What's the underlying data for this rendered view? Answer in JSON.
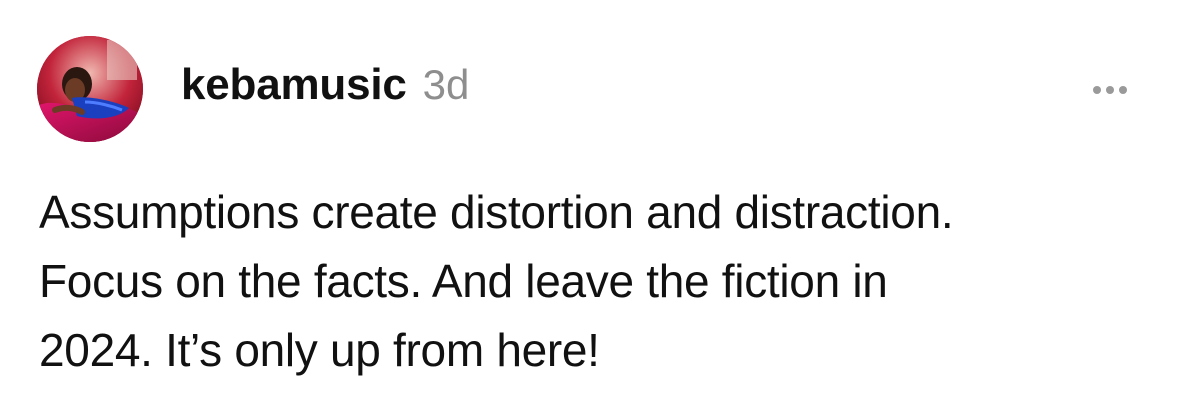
{
  "post": {
    "author": {
      "username": "kebamusic",
      "avatar_icon": "profile-photo"
    },
    "timestamp": "3d",
    "more_icon": "ellipsis-icon",
    "body_lines": [
      "Assumptions create distortion and distraction.",
      "Focus on the facts. And leave the fiction in",
      "2024. It’s only up from here!"
    ]
  },
  "colors": {
    "text": "#111111",
    "muted": "#8e8e8e",
    "background": "#ffffff"
  }
}
